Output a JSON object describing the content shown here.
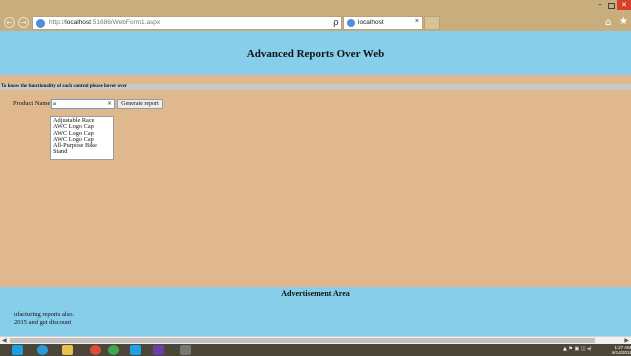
{
  "browser": {
    "url_prefix": "http://",
    "url_host": "localhost",
    "url_rest": ":51686/WebForm1.aspx",
    "tab_title": "localhost",
    "tab_close": "×",
    "back_icon": "arrow-left-icon",
    "forward_icon": "arrow-right-icon",
    "search_glyph": "ρ ▾ ↻"
  },
  "page": {
    "title": "Advanced Reports Over Web",
    "hint": "To know the functionality of each control please hover over",
    "product_label": "Product Name",
    "product_value": "a",
    "clear_glyph": "×",
    "generate_button": "Generate report",
    "suggestions": [
      "Adjustable Race",
      "AWC Logo Cap",
      "AWC Logo Cap",
      "AWC Logo Cap",
      "All-Purpose Bike",
      "Stand"
    ],
    "footer_title": "Advertisement Area",
    "ad_line1": "ufacturing reports also.",
    "ad_line2": "2015 and get discount"
  },
  "taskbar": {
    "tray": "▲ ⚑ ▣ ◫ ◂)",
    "time": "1:27 AM",
    "date": "6/14/2015"
  },
  "colors": {
    "header_bg": "#87ceeb",
    "body_bg": "#dfb88e",
    "chrome_bg": "#c8ae7d",
    "taskbar_bg": "#4b4637"
  }
}
